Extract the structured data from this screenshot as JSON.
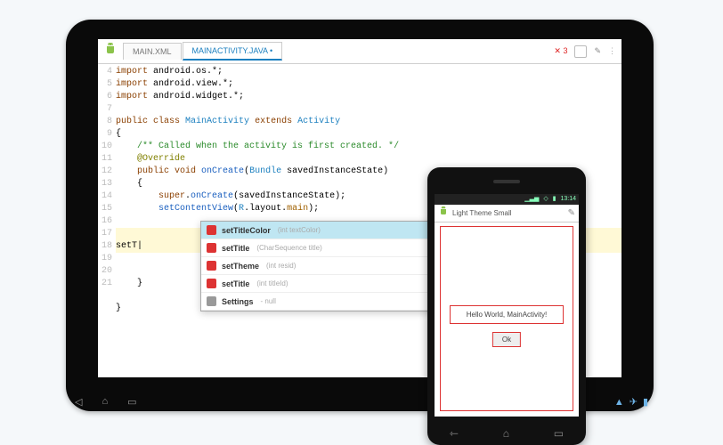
{
  "tablet": {
    "tabs": [
      {
        "label": "MAIN.XML",
        "active": false
      },
      {
        "label": "MAINACTIVITY.JAVA •",
        "active": true
      }
    ],
    "errors_count": "3",
    "code_lines": [
      {
        "n": 4,
        "html": "<span class='kw'>import</span> android.os.*;"
      },
      {
        "n": 5,
        "html": "<span class='kw'>import</span> android.view.*;"
      },
      {
        "n": 6,
        "html": "<span class='kw'>import</span> android.widget.*;"
      },
      {
        "n": 7,
        "html": ""
      },
      {
        "n": 8,
        "html": "<span class='kw'>public class</span> <span class='cls'>MainActivity</span> <span class='kw'>extends</span> <span class='cls'>Activity</span>"
      },
      {
        "n": 9,
        "html": "{"
      },
      {
        "n": 10,
        "html": "    <span class='com'>/** Called when the activity is first created. */</span>"
      },
      {
        "n": 11,
        "html": "    <span class='ann'>@Override</span>"
      },
      {
        "n": 12,
        "html": "    <span class='kw'>public void</span> <span class='fn'>onCreate</span>(<span class='cls'>Bundle</span> savedInstanceState)"
      },
      {
        "n": 13,
        "html": "    {"
      },
      {
        "n": 14,
        "html": "        <span class='kw'>super</span>.<span class='fn'>onCreate</span>(savedInstanceState);"
      },
      {
        "n": 15,
        "html": "        <span class='fn'>setContentView</span>(<span class='cls'>R</span>.layout.<span class='str'>main</span>);"
      },
      {
        "n": 16,
        "html": ""
      },
      {
        "n": 17,
        "html": "        <span class='hl'>setT|</span>",
        "hl": true
      },
      {
        "n": 18,
        "html": ""
      },
      {
        "n": 19,
        "html": "    }"
      },
      {
        "n": 20,
        "html": ""
      },
      {
        "n": 21,
        "html": "}"
      }
    ],
    "current_input": "setT",
    "autocomplete": [
      {
        "name": "setTitleColor",
        "params": "(int textColor)",
        "selected": true,
        "icon": "method"
      },
      {
        "name": "setTitle",
        "params": "(CharSequence title)",
        "selected": false,
        "icon": "method"
      },
      {
        "name": "setTheme",
        "params": "(int resid)",
        "selected": false,
        "icon": "method"
      },
      {
        "name": "setTitle",
        "params": "(int titleId)",
        "selected": false,
        "icon": "method"
      },
      {
        "name": "Settings",
        "params": " - null",
        "selected": false,
        "icon": "settings"
      }
    ],
    "nav_time": ""
  },
  "phone": {
    "status": {
      "time": "13:14"
    },
    "toolbar_title": "Light Theme Small",
    "message": "Hello World, MainActivity!",
    "button": "Ok"
  }
}
